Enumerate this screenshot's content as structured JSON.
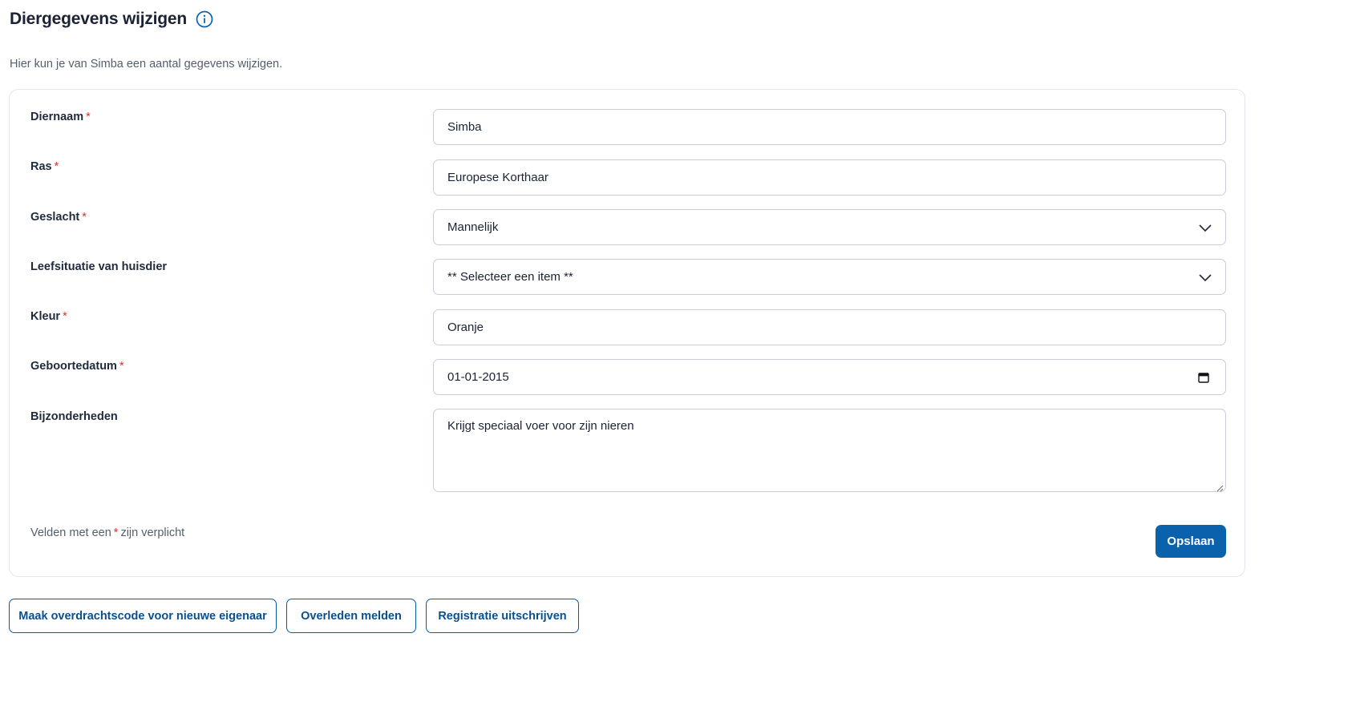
{
  "header": {
    "title": "Diergegevens wijzigen",
    "info_icon": "info-circle-icon",
    "subtitle": "Hier kun je van Simba een aantal gegevens wijzigen."
  },
  "form": {
    "fields": [
      {
        "label": "Diernaam",
        "required": true,
        "type": "text",
        "value": "Simba"
      },
      {
        "label": "Ras",
        "required": true,
        "type": "text",
        "value": "Europese Korthaar"
      },
      {
        "label": "Geslacht",
        "required": true,
        "type": "select",
        "value": "Mannelijk"
      },
      {
        "label": "Leefsituatie van huisdier",
        "required": false,
        "type": "select",
        "value": "** Selecteer een item **"
      },
      {
        "label": "Kleur",
        "required": true,
        "type": "text",
        "value": "Oranje"
      },
      {
        "label": "Geboortedatum",
        "required": true,
        "type": "date",
        "value": "01-01-2015"
      },
      {
        "label": "Bijzonderheden",
        "required": false,
        "type": "textarea",
        "value": "Krijgt speciaal voer voor zijn nieren"
      }
    ],
    "required_star": "*",
    "required_note_before": "Velden met een",
    "required_note_after": "zijn verplicht",
    "save_label": "Opslaan"
  },
  "actions": {
    "transfer_code": "Maak overdrachtscode voor nieuwe eigenaar",
    "report_deceased": "Overleden melden",
    "unregister": "Registratie uitschrijven"
  },
  "colors": {
    "primary": "#0a62ad",
    "required": "#e0302a",
    "text": "#1a2233",
    "muted": "#555e6b",
    "border": "#c9ced6"
  }
}
